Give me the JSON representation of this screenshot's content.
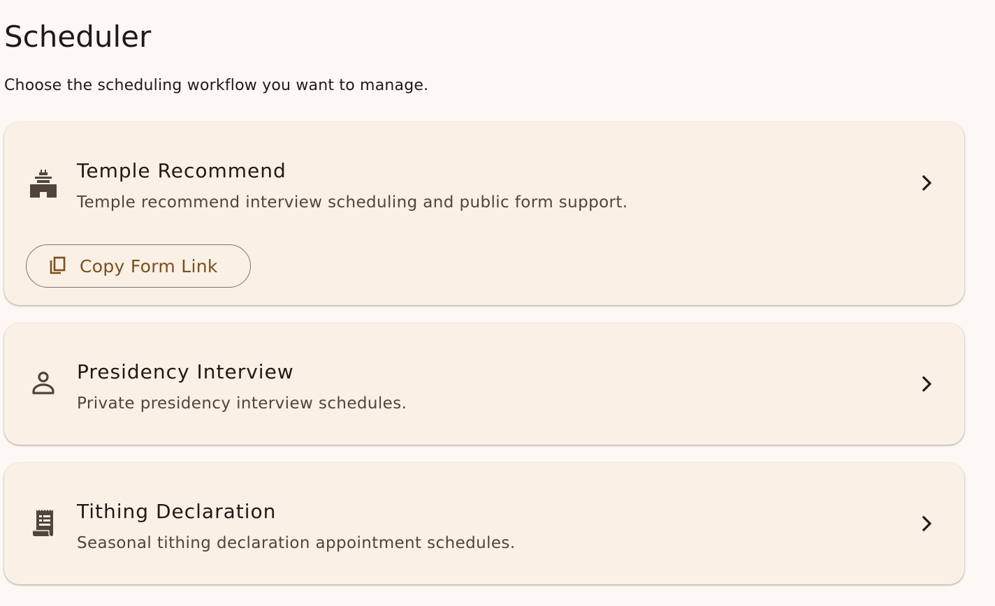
{
  "page": {
    "title": "Scheduler",
    "subtitle": "Choose the scheduling workflow you want to manage."
  },
  "cards": [
    {
      "title": "Temple Recommend",
      "description": "Temple recommend interview scheduling and public form support.",
      "icon": "temple-icon",
      "action": {
        "label": "Copy Form Link",
        "icon": "copy-icon"
      }
    },
    {
      "title": "Presidency Interview",
      "description": "Private presidency interview schedules.",
      "icon": "person-icon"
    },
    {
      "title": "Tithing Declaration",
      "description": "Seasonal tithing declaration appointment schedules.",
      "icon": "receipt-icon"
    }
  ],
  "colors": {
    "background": "#fdf8f3",
    "card": "#fbf0e6",
    "icon": "#51443b",
    "button_text": "#7a4f1e",
    "button_outline": "#85736a"
  }
}
